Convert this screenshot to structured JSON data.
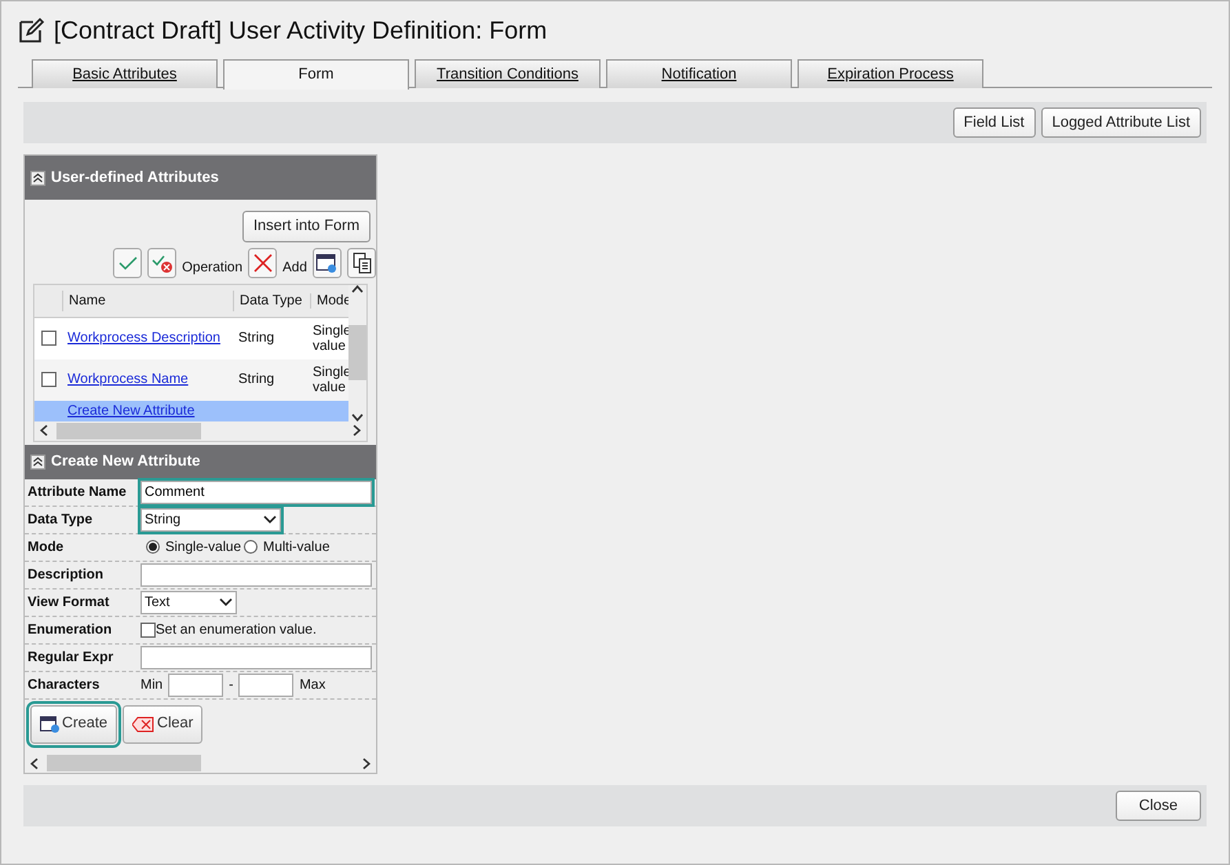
{
  "window": {
    "title": "[Contract Draft] User Activity Definition: Form"
  },
  "tabs": [
    {
      "label": "Basic Attributes",
      "selected": false
    },
    {
      "label": "Form",
      "selected": true
    },
    {
      "label": "Transition Conditions",
      "selected": false
    },
    {
      "label": "Notification",
      "selected": false
    },
    {
      "label": "Expiration Process",
      "selected": false
    }
  ],
  "toolbar_buttons": [
    "Field List",
    "Logged Attribute List"
  ],
  "attributes_panel": {
    "title": "User-defined Attributes",
    "insert_button": "Insert into Form",
    "operation_label": "Operation",
    "add_label": "Add",
    "table": {
      "columns": [
        "Name",
        "Data Type",
        "Mode"
      ],
      "rows": [
        {
          "name": "Workprocess Description",
          "data_type": "String",
          "mode": "Single value",
          "checked": false
        },
        {
          "name": "Workprocess Name",
          "data_type": "String",
          "mode": "Single value",
          "checked": false
        }
      ],
      "new_row": {
        "label": "Create New Attribute",
        "selected": true
      }
    }
  },
  "create_panel": {
    "title": "Create New Attribute",
    "fields": [
      {
        "kind": "text",
        "label": "Attribute Name",
        "value": "Comment",
        "highlighted": true
      },
      {
        "kind": "select",
        "label": "Data Type",
        "value": "String",
        "highlighted": true
      },
      {
        "kind": "radio",
        "label": "Mode",
        "options": [
          {
            "label": "Single-value",
            "selected": true
          },
          {
            "label": "Multi-value",
            "selected": false
          }
        ]
      },
      {
        "kind": "text",
        "label": "Description",
        "highlighted": false
      },
      {
        "kind": "select_small",
        "label": "View Format",
        "value": "Text",
        "highlighted": false
      },
      {
        "kind": "checkbox",
        "label": "Enumeration",
        "option": "Set an enumeration value.",
        "checked": false
      },
      {
        "kind": "text",
        "label": "Regular Expr",
        "highlighted": false
      },
      {
        "kind": "range",
        "label": "Characters",
        "min_label": "Min",
        "separator": "-",
        "max_label": "Max"
      }
    ],
    "buttons": [
      {
        "kind": "create",
        "label": "Create",
        "highlighted": true
      },
      {
        "kind": "clear",
        "label": "Clear",
        "highlighted": false
      }
    ]
  },
  "footer_button": "Close"
}
